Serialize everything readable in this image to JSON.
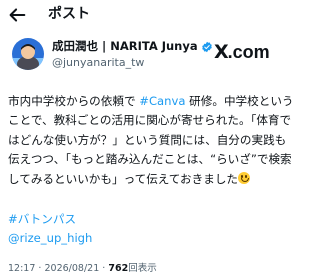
{
  "header": {
    "title": "ポスト"
  },
  "author": {
    "name": "成田潤也 | NARITA Junya",
    "handle": "@junyanarita_tw",
    "verified_color": "#1d9bf0"
  },
  "brand": {
    "logo_mark": "X",
    "logo_suffix": ".com"
  },
  "post": {
    "line1_pre": "市内中学校からの依頼で",
    "hashtag1": "#Canva",
    "line1_post": "研修。中学校ということで、教科ごとの活用に関心が寄せられた。「体育ではどんな使い方が？」という質問には、自分の実践も伝えつつ、「もっと踏み込んだことは、“らいざ”で検索してみるといいかも」って伝えておきました",
    "hashtag2": "#バトンパス",
    "mention": "@rize_up_high"
  },
  "meta": {
    "time": "12:17",
    "date": "2026/08/21",
    "views_count": "762",
    "views_label": "回表示"
  },
  "colors": {
    "accent": "#1d9bf0",
    "text": "#0f1419",
    "muted": "#536471"
  }
}
